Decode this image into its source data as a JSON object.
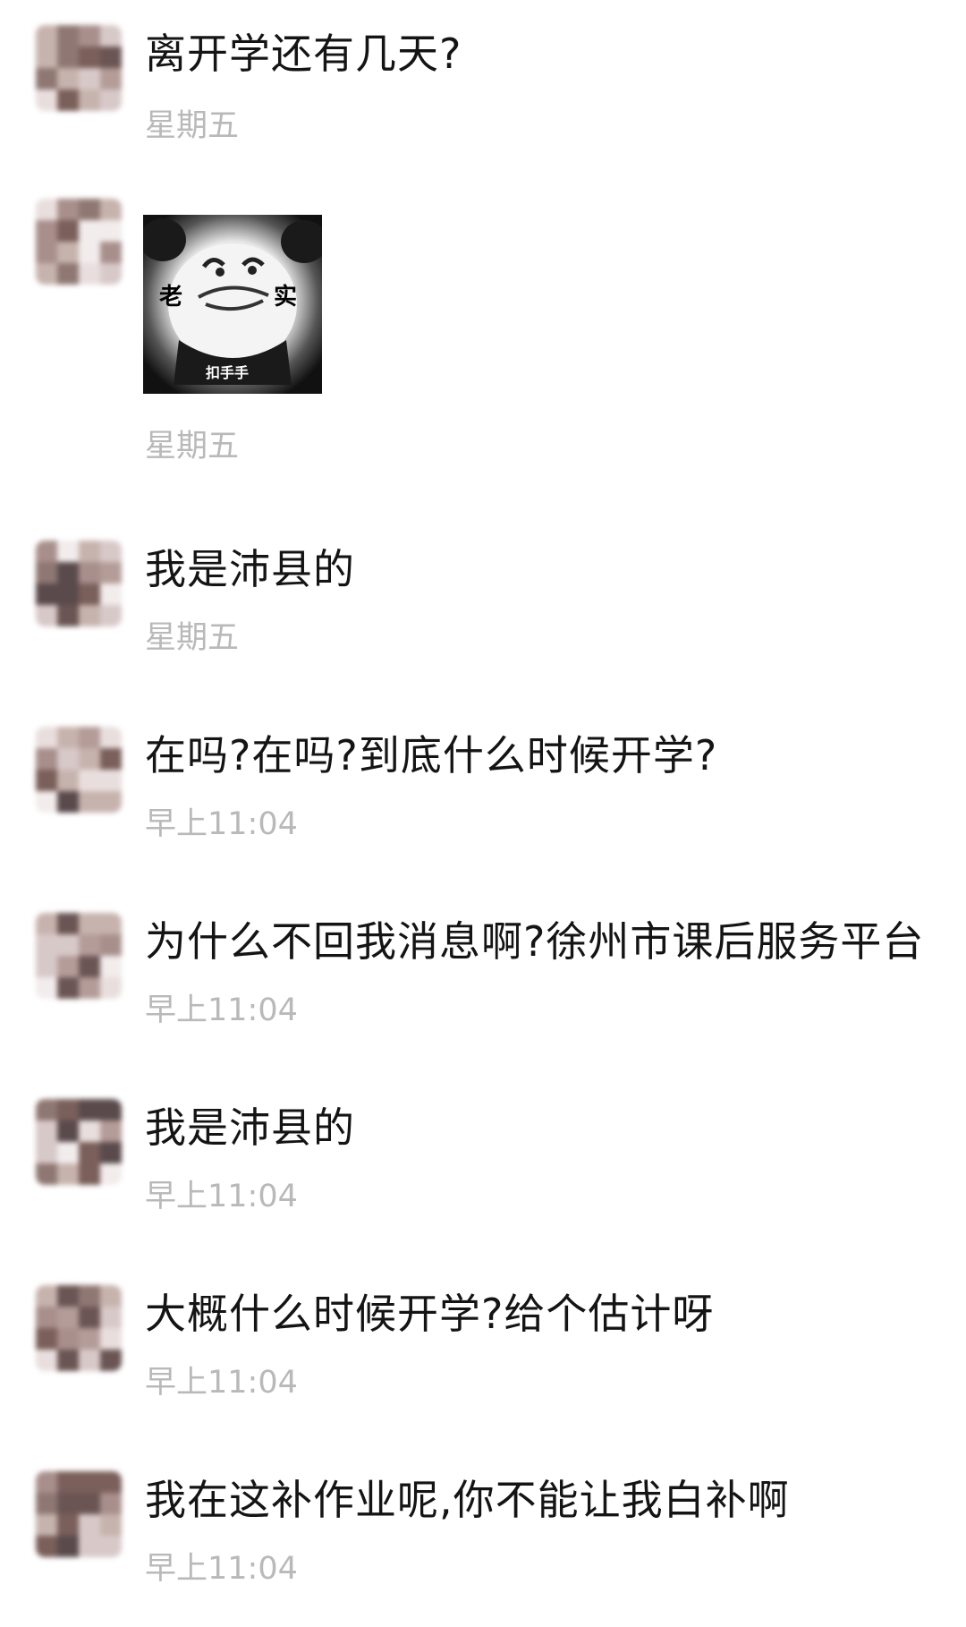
{
  "messages": [
    {
      "text": "离开学还有几天?",
      "time": "星期五"
    },
    {
      "type": "sticker",
      "sticker": {
        "left_text": "老",
        "right_text": "实",
        "caption": "扣手手"
      },
      "time": "星期五"
    },
    {
      "text": "我是沛县的",
      "time": "星期五"
    },
    {
      "text": "在吗?在吗?到底什么时候开学?",
      "time": "早上11:04"
    },
    {
      "text": "为什么不回我消息啊?徐州市课后服务平台",
      "time": "早上11:04"
    },
    {
      "text": "我是沛县的",
      "time": "早上11:04"
    },
    {
      "text": "大概什么时候开学?给个估计呀",
      "time": "早上11:04"
    },
    {
      "text": "我在这补作业呢,你不能让我白补啊",
      "time": "早上11:04"
    }
  ],
  "colors": {
    "message_text": "#141414",
    "timestamp": "#b9b9b9",
    "background": "#ffffff"
  },
  "icons": {
    "avatar": "pixelated-avatar",
    "sticker": "panda-meme-sticker"
  }
}
